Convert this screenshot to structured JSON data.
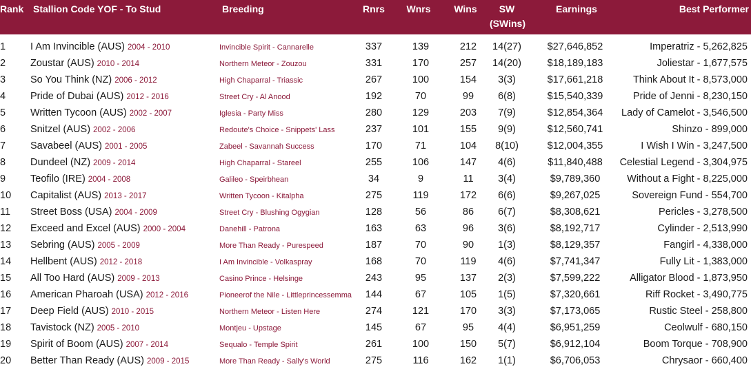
{
  "header": {
    "rank": "Rank",
    "stallion": "Stallion Code YOF - To Stud",
    "breeding": "Breeding",
    "rnrs": "Rnrs",
    "wnrs": "Wnrs",
    "wins": "Wins",
    "sw": "SW",
    "swins": "(SWins)",
    "earnings": "Earnings",
    "best": "Best Performer"
  },
  "rows": [
    {
      "rank": "1",
      "name": "I Am Invincible (AUS)",
      "yof": "2004 - 2010",
      "breeding": "Invincible Spirit - Cannarelle",
      "rnrs": "337",
      "wnrs": "139",
      "wins": "212",
      "sw": "14(27)",
      "earnings": "$27,646,852",
      "best": "Imperatriz - 5,262,825"
    },
    {
      "rank": "2",
      "name": "Zoustar (AUS)",
      "yof": "2010 - 2014",
      "breeding": "Northern Meteor - Zouzou",
      "rnrs": "331",
      "wnrs": "170",
      "wins": "257",
      "sw": "14(20)",
      "earnings": "$18,189,183",
      "best": "Joliestar - 1,677,575"
    },
    {
      "rank": "3",
      "name": "So You Think (NZ)",
      "yof": "2006 - 2012",
      "breeding": "High Chaparral - Triassic",
      "rnrs": "267",
      "wnrs": "100",
      "wins": "154",
      "sw": "3(3)",
      "earnings": "$17,661,218",
      "best": "Think About It - 8,573,000"
    },
    {
      "rank": "4",
      "name": "Pride of Dubai (AUS)",
      "yof": "2012 - 2016",
      "breeding": "Street Cry - Al Anood",
      "rnrs": "192",
      "wnrs": "70",
      "wins": "99",
      "sw": "6(8)",
      "earnings": "$15,540,339",
      "best": "Pride of Jenni - 8,230,150"
    },
    {
      "rank": "5",
      "name": "Written Tycoon (AUS)",
      "yof": "2002 - 2007",
      "breeding": "Iglesia - Party Miss",
      "rnrs": "280",
      "wnrs": "129",
      "wins": "203",
      "sw": "7(9)",
      "earnings": "$12,854,364",
      "best": "Lady of Camelot - 3,546,500"
    },
    {
      "rank": "6",
      "name": "Snitzel (AUS)",
      "yof": "2002 - 2006",
      "breeding": "Redoute's Choice - Snippets' Lass",
      "rnrs": "237",
      "wnrs": "101",
      "wins": "155",
      "sw": "9(9)",
      "earnings": "$12,560,741",
      "best": "Shinzo - 899,000"
    },
    {
      "rank": "7",
      "name": "Savabeel (AUS)",
      "yof": "2001 - 2005",
      "breeding": "Zabeel - Savannah Success",
      "rnrs": "170",
      "wnrs": "71",
      "wins": "104",
      "sw": "8(10)",
      "earnings": "$12,004,355",
      "best": "I Wish I Win - 3,247,500"
    },
    {
      "rank": "8",
      "name": "Dundeel (NZ)",
      "yof": "2009 - 2014",
      "breeding": "High Chaparral - Stareel",
      "rnrs": "255",
      "wnrs": "106",
      "wins": "147",
      "sw": "4(6)",
      "earnings": "$11,840,488",
      "best": "Celestial Legend - 3,304,975"
    },
    {
      "rank": "9",
      "name": "Teofilo (IRE)",
      "yof": "2004 - 2008",
      "breeding": "Galileo - Speirbhean",
      "rnrs": "34",
      "wnrs": "9",
      "wins": "11",
      "sw": "3(4)",
      "earnings": "$9,789,360",
      "best": "Without a Fight - 8,225,000"
    },
    {
      "rank": "10",
      "name": "Capitalist (AUS)",
      "yof": "2013 - 2017",
      "breeding": "Written Tycoon - Kitalpha",
      "rnrs": "275",
      "wnrs": "119",
      "wins": "172",
      "sw": "6(6)",
      "earnings": "$9,267,025",
      "best": "Sovereign Fund - 554,700"
    },
    {
      "rank": "11",
      "name": "Street Boss (USA)",
      "yof": "2004 - 2009",
      "breeding": "Street Cry - Blushing Ogygian",
      "rnrs": "128",
      "wnrs": "56",
      "wins": "86",
      "sw": "6(7)",
      "earnings": "$8,308,621",
      "best": "Pericles - 3,278,500"
    },
    {
      "rank": "12",
      "name": "Exceed and Excel (AUS)",
      "yof": "2000 - 2004",
      "breeding": "Danehill - Patrona",
      "rnrs": "163",
      "wnrs": "63",
      "wins": "96",
      "sw": "3(6)",
      "earnings": "$8,192,717",
      "best": "Cylinder - 2,513,990"
    },
    {
      "rank": "13",
      "name": "Sebring (AUS)",
      "yof": "2005 - 2009",
      "breeding": "More Than Ready - Purespeed",
      "rnrs": "187",
      "wnrs": "70",
      "wins": "90",
      "sw": "1(3)",
      "earnings": "$8,129,357",
      "best": "Fangirl - 4,338,000"
    },
    {
      "rank": "14",
      "name": "Hellbent (AUS)",
      "yof": "2012 - 2018",
      "breeding": "I Am Invincible - Volkaspray",
      "rnrs": "168",
      "wnrs": "70",
      "wins": "119",
      "sw": "4(6)",
      "earnings": "$7,741,347",
      "best": "Fully Lit - 1,383,000"
    },
    {
      "rank": "15",
      "name": "All Too Hard (AUS)",
      "yof": "2009 - 2013",
      "breeding": "Casino Prince - Helsinge",
      "rnrs": "243",
      "wnrs": "95",
      "wins": "137",
      "sw": "2(3)",
      "earnings": "$7,599,222",
      "best": "Alligator Blood - 1,873,950"
    },
    {
      "rank": "16",
      "name": "American Pharoah (USA)",
      "yof": "2012 - 2016",
      "breeding": "Pioneerof the Nile - Littleprincessemma",
      "rnrs": "144",
      "wnrs": "67",
      "wins": "105",
      "sw": "1(5)",
      "earnings": "$7,320,661",
      "best": "Riff Rocket - 3,490,775"
    },
    {
      "rank": "17",
      "name": "Deep Field (AUS)",
      "yof": "2010 - 2015",
      "breeding": "Northern Meteor - Listen Here",
      "rnrs": "274",
      "wnrs": "121",
      "wins": "170",
      "sw": "3(3)",
      "earnings": "$7,173,065",
      "best": "Rustic Steel - 258,800"
    },
    {
      "rank": "18",
      "name": "Tavistock (NZ)",
      "yof": "2005 - 2010",
      "breeding": "Montjeu - Upstage",
      "rnrs": "145",
      "wnrs": "67",
      "wins": "95",
      "sw": "4(4)",
      "earnings": "$6,951,259",
      "best": "Ceolwulf - 680,150"
    },
    {
      "rank": "19",
      "name": "Spirit of Boom (AUS)",
      "yof": "2007 - 2014",
      "breeding": "Sequalo - Temple Spirit",
      "rnrs": "261",
      "wnrs": "100",
      "wins": "150",
      "sw": "5(7)",
      "earnings": "$6,912,104",
      "best": "Boom Torque - 708,900"
    },
    {
      "rank": "20",
      "name": "Better Than Ready (AUS)",
      "yof": "2009 - 2015",
      "breeding": "More Than Ready - Sally's World",
      "rnrs": "275",
      "wnrs": "116",
      "wins": "162",
      "sw": "1(1)",
      "earnings": "$6,706,053",
      "best": "Chrysaor - 660,400"
    }
  ]
}
